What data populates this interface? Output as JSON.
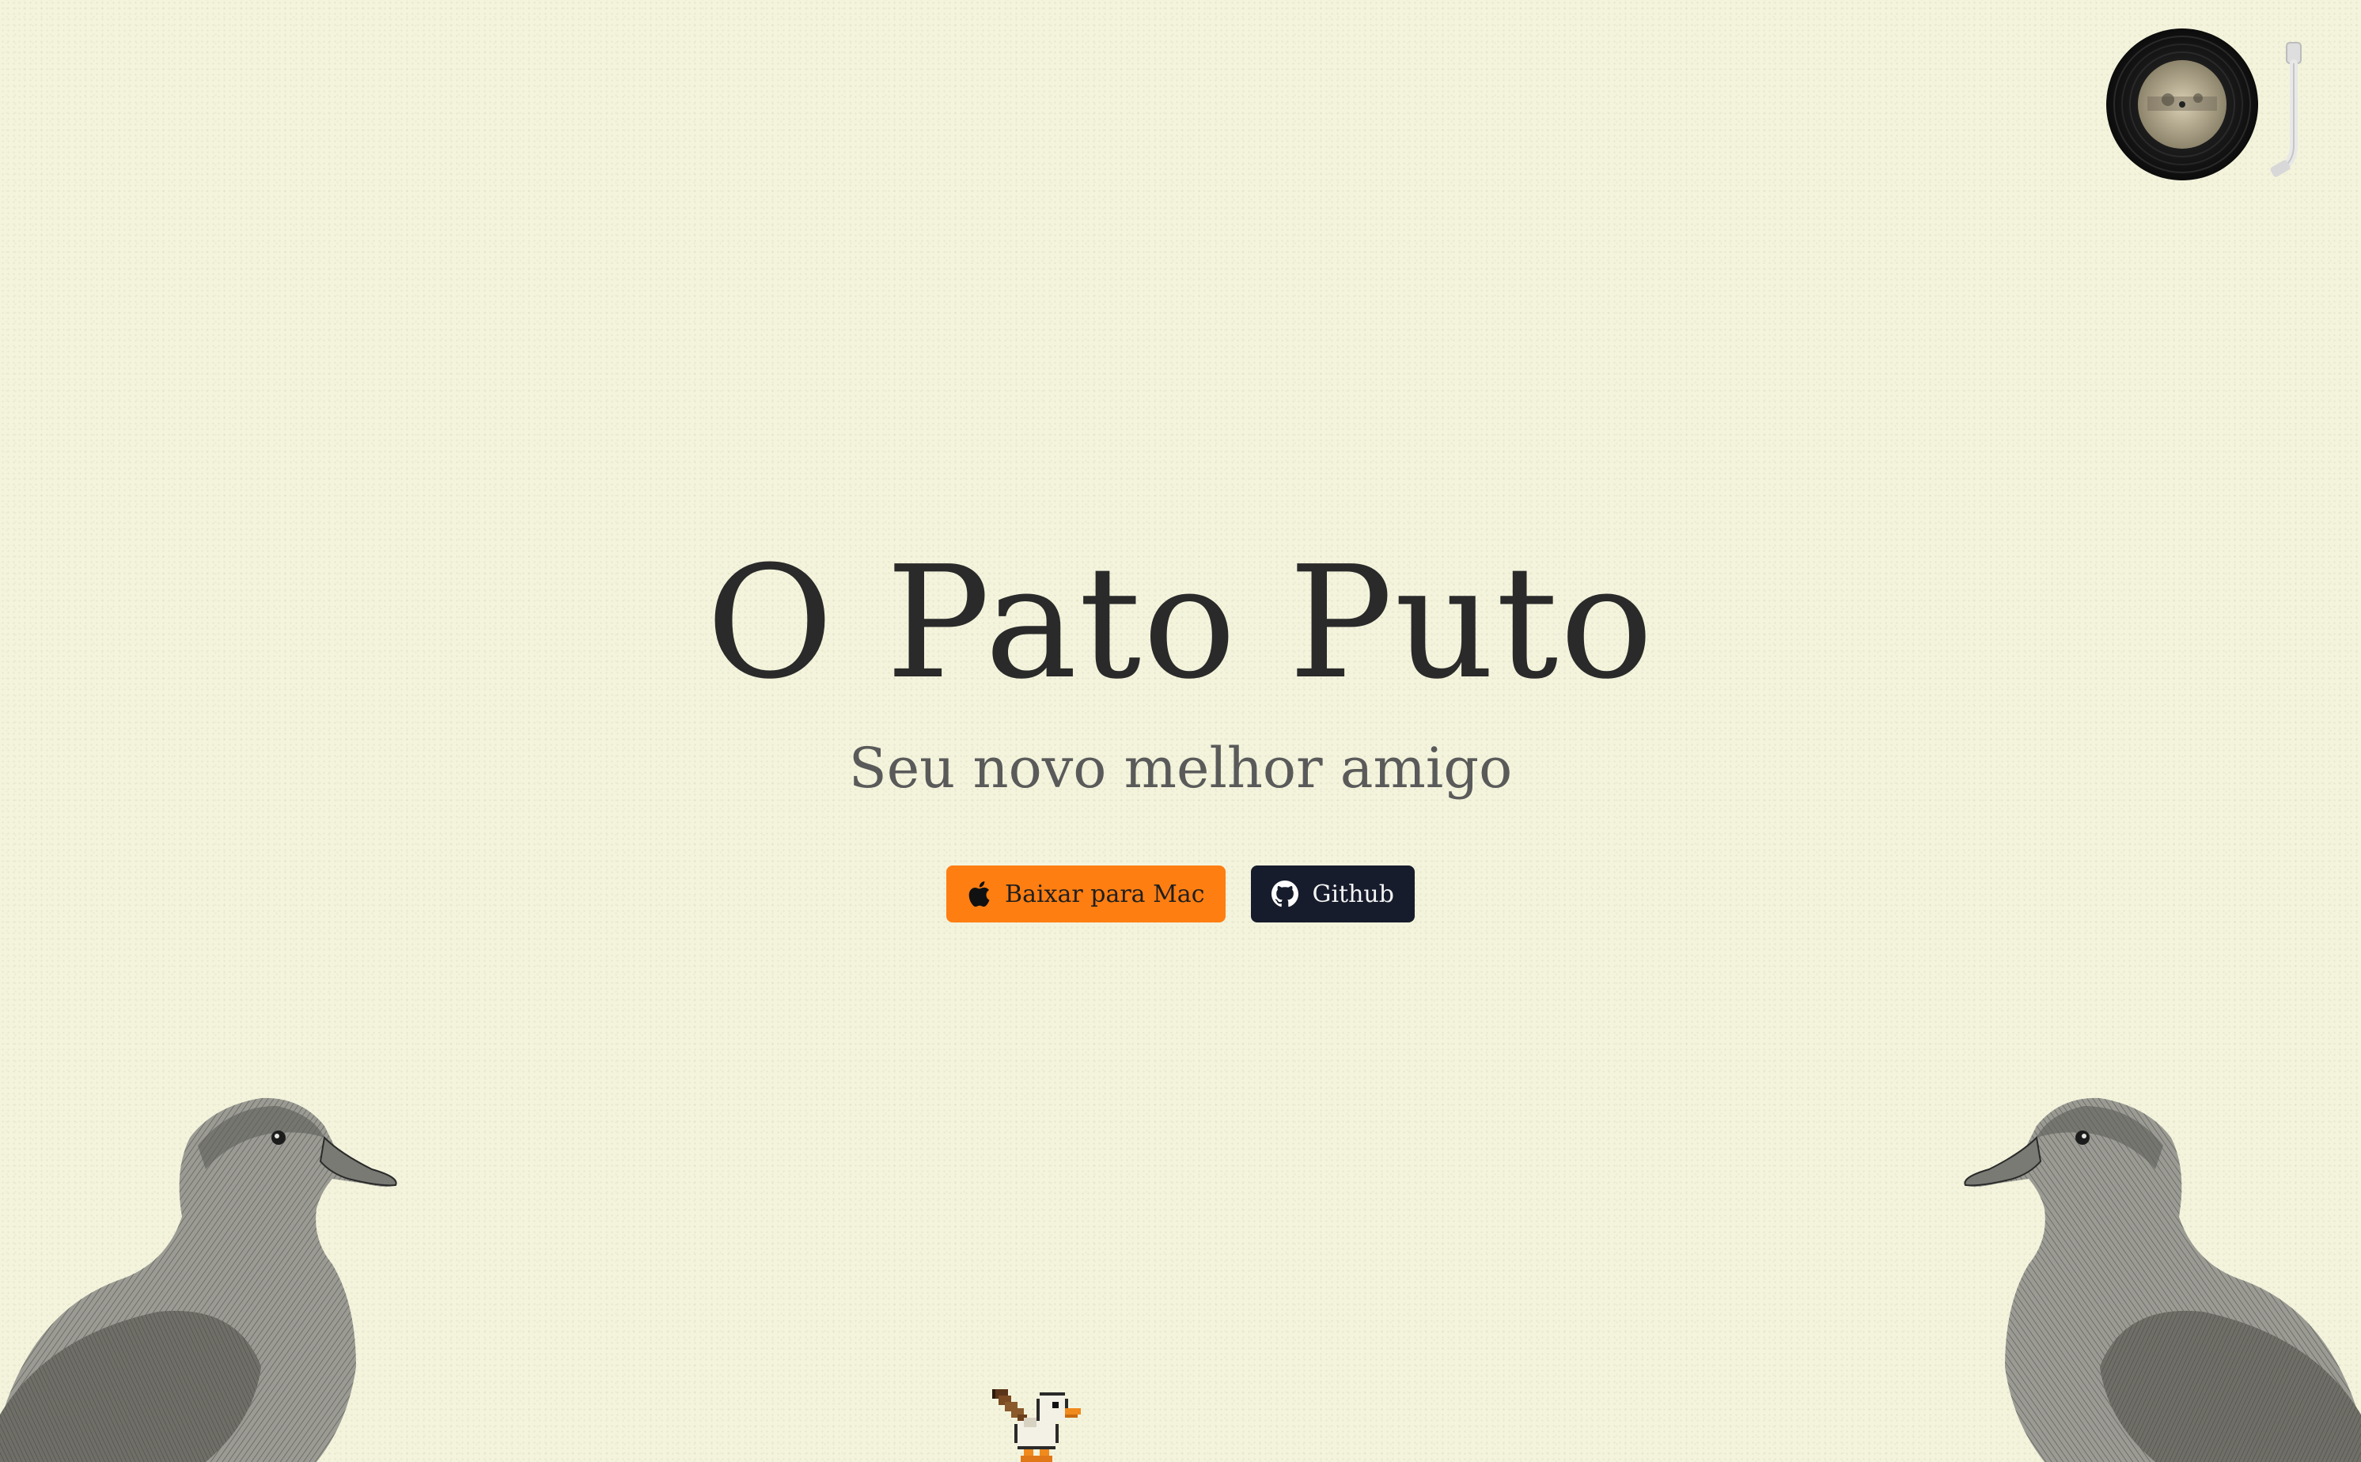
{
  "hero": {
    "title": "O Pato Puto",
    "subtitle": "Seu novo melhor amigo"
  },
  "actions": {
    "download_mac_label": "Baixar para Mac",
    "github_label": "Github"
  },
  "icons": {
    "download": "apple-icon",
    "github": "github-icon",
    "music": "record-player-icon"
  },
  "colors": {
    "background": "#f4f4dd",
    "title": "#2a2a2a",
    "subtitle": "#5a5a5a",
    "mac_button": "#ff7e12",
    "github_button": "#161c2c"
  }
}
